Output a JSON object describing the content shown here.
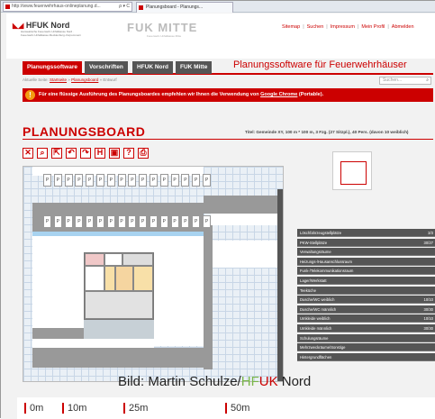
{
  "browser": {
    "address": "http://www.feuerwehrhaus-onlineplanung.d...",
    "address_controls": "ρ ▾ C",
    "tab_title": "Planungsboard - Planungs..."
  },
  "header": {
    "logo_hfuk": "HFUK Nord",
    "logo_hfuk_sub": "Hanseatische Feuerwehr-Unfallkasse Nord · Feuerwehr-Unfallkasse Mecklenburg-Vorpommern",
    "logo_fuk": "FUK MITTE",
    "logo_fuk_sub": "Feuerwehr-Unfallkasse Mitte",
    "links": [
      "Sitemap",
      "Suchen",
      "Impressum",
      "Mein Profil",
      "Abmelden"
    ]
  },
  "nav": {
    "tabs": [
      "Planungssoftware",
      "Vorschriften",
      "HFUK Nord",
      "FUK Mitte"
    ],
    "app_title": "Planungssoftware für Feuerwehrhäuser"
  },
  "breadcrumb": {
    "prefix": "Aktuelle Seite:",
    "items": [
      "Startseite",
      "Planungsboard"
    ],
    "current": "Entwurf"
  },
  "search": {
    "placeholder": "Suchen..."
  },
  "notice": {
    "icon": "!",
    "text": "Für eine flüssige Ausführung des Planungsboardes empfehlen wir Ihnen die Verwendung von ",
    "link": "Google Chrome",
    "suffix": " (Portable)."
  },
  "board": {
    "title": "PLANUNGSBOARD",
    "info": "Titel: Gemeinde XY, 100 m * 100 m, 3 Fzg. (27 Sitzpl.), 40 Pers. (davon 10 weiblich)"
  },
  "toolbar": [
    {
      "icon": "close-icon",
      "glyph": "✕"
    },
    {
      "icon": "search-icon",
      "glyph": "⌕"
    },
    {
      "icon": "export-icon",
      "glyph": "⇱"
    },
    {
      "icon": "undo-icon",
      "glyph": "↶"
    },
    {
      "icon": "redo-icon",
      "glyph": "↷"
    },
    {
      "icon": "save-icon",
      "glyph": "H"
    },
    {
      "icon": "image-icon",
      "glyph": "▣"
    },
    {
      "icon": "help-icon",
      "glyph": "?"
    },
    {
      "icon": "print-icon",
      "glyph": "⎙"
    }
  ],
  "parking_label": "P",
  "legend": [
    {
      "label": "Löschfahrzeugstellplätze",
      "value": "3/3"
    },
    {
      "label": "PKW-Stellplätze",
      "value": "30/27"
    },
    {
      "label": "Verwaltungsräume",
      "value": ""
    },
    {
      "label": "Heizungs-/Hausanschlussraum",
      "value": ""
    },
    {
      "label": "Funk-/Telekommunikationsraum",
      "value": ""
    },
    {
      "label": "Lager/Werkstatt",
      "value": ""
    },
    {
      "label": "Teeküche",
      "value": ""
    },
    {
      "label": "Dusche/WC weiblich",
      "value": "10/10"
    },
    {
      "label": "Dusche/WC männlich",
      "value": "30/30"
    },
    {
      "label": "Umkleide weiblich",
      "value": "10/10"
    },
    {
      "label": "Umkleide männlich",
      "value": "30/30"
    },
    {
      "label": "Schulungsräume",
      "value": ""
    },
    {
      "label": "Mehrzweckräume/Sonstige",
      "value": ""
    },
    {
      "label": "Hintergrundflächen",
      "value": ""
    }
  ],
  "credit": {
    "prefix": "Bild: Martin Schulze/",
    "hf": "HF",
    "uk": "UK",
    "nord": " Nord"
  },
  "scale": [
    "0m",
    "10m",
    "25m",
    "50m"
  ]
}
